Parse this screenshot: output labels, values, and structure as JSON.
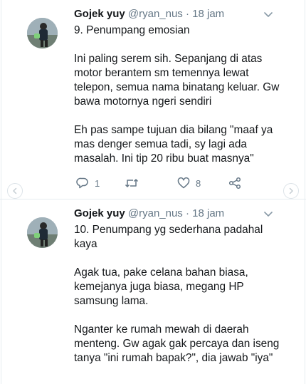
{
  "tweets": [
    {
      "display_name": "Gojek yuy",
      "handle": "@ryan_nus",
      "separator": "·",
      "time": "18 jam",
      "text": "9. Penumpang emosian\n\nIni paling serem sih. Sepanjang di atas motor berantem sm temennya lewat telepon, semua nama binatang keluar. Gw bawa motornya ngeri sendiri\n\nEh pas sampe tujuan dia bilang \"maaf ya mas denger semua tadi, sy lagi ada masalah. Ini tip 20 ribu buat masnya\"",
      "reply_count": "1",
      "retweet_count": "",
      "like_count": "8"
    },
    {
      "display_name": "Gojek yuy",
      "handle": "@ryan_nus",
      "separator": "·",
      "time": "18 jam",
      "text": "10. Penumpang yg sederhana padahal kaya\n\nAgak tua, pake celana bahan biasa, kemejanya juga biasa, megang HP samsung lama.\n\nNganter ke rumah mewah di daerah menteng. Gw agak gak percaya dan iseng tanya \"ini rumah bapak?\", dia jawab \"iya\""
    }
  ],
  "icons": {
    "reply": "reply-icon",
    "retweet": "retweet-icon",
    "like": "heart-icon",
    "share": "share-icon",
    "more": "chevron-down-icon",
    "scroll_left": "chevron-left-icon",
    "scroll_right": "chevron-right-icon"
  },
  "colors": {
    "text": "#14171a",
    "muted": "#657786",
    "border": "#e6ecf0"
  }
}
